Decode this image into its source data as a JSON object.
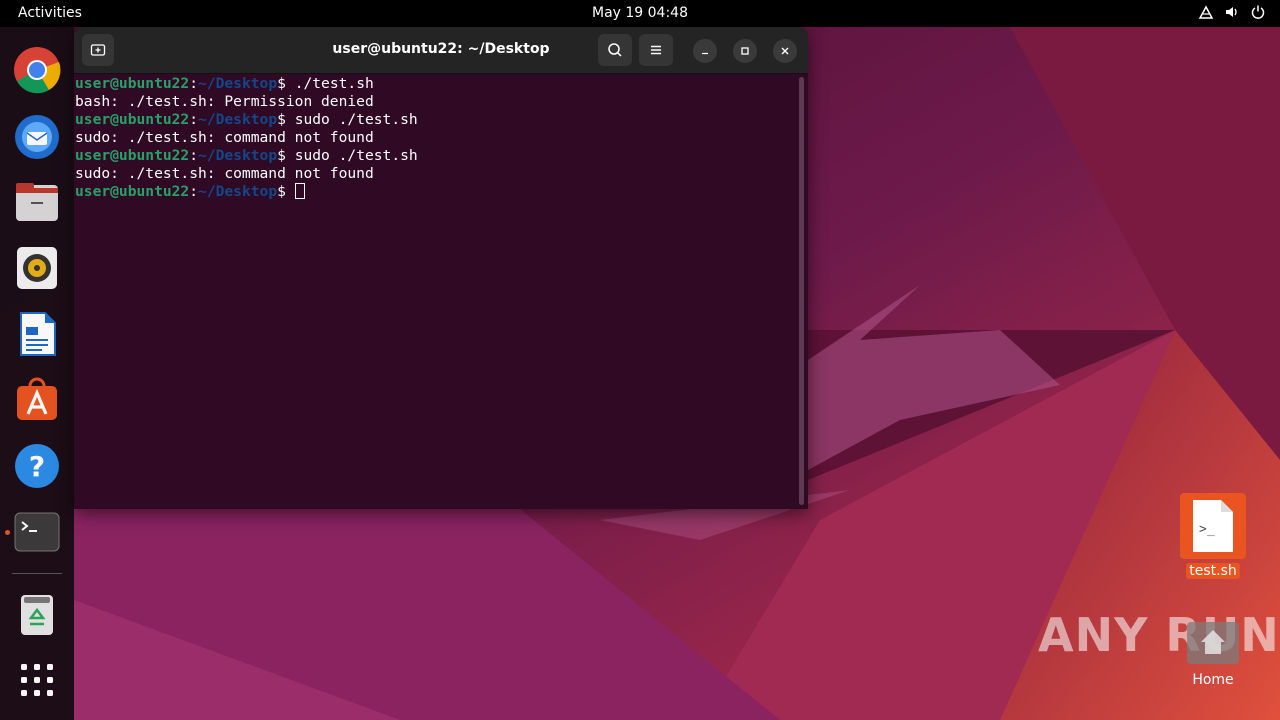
{
  "topbar": {
    "activities": "Activities",
    "clock": "May 19  04:48",
    "tray_icons": [
      "network-icon",
      "volume-icon",
      "power-icon"
    ]
  },
  "dock": {
    "items": [
      {
        "name": "chrome",
        "icon": "chrome-icon"
      },
      {
        "name": "thunderbird",
        "icon": "thunderbird-icon"
      },
      {
        "name": "files",
        "icon": "files-icon"
      },
      {
        "name": "rhythmbox",
        "icon": "rhythmbox-icon"
      },
      {
        "name": "libreoffice-writer",
        "icon": "writer-icon"
      },
      {
        "name": "app-center",
        "icon": "app-center-icon"
      },
      {
        "name": "help",
        "icon": "help-icon"
      },
      {
        "name": "terminal",
        "icon": "terminal-icon",
        "running": true
      },
      {
        "name": "trash",
        "icon": "trash-icon"
      },
      {
        "name": "show-apps",
        "icon": "app-grid-icon"
      }
    ]
  },
  "terminal": {
    "title": "user@ubuntu22: ~/Desktop",
    "prompt_user": "user@ubuntu22",
    "prompt_sep": ":",
    "prompt_path": "~/Desktop",
    "prompt_symbol": "$ ",
    "lines": [
      {
        "type": "cmd",
        "text": "./test.sh"
      },
      {
        "type": "out",
        "text": "bash: ./test.sh: Permission denied"
      },
      {
        "type": "cmd",
        "text": "sudo ./test.sh"
      },
      {
        "type": "out",
        "text": "sudo: ./test.sh: command not found"
      },
      {
        "type": "cmd",
        "text": "sudo ./test.sh"
      },
      {
        "type": "out",
        "text": "sudo: ./test.sh: command not found"
      },
      {
        "type": "cmd",
        "text": ""
      }
    ]
  },
  "desktop": {
    "file_label": "test.sh",
    "file_icon_text": ">_",
    "home_label": "Home"
  },
  "watermark": "ANY RUN",
  "colors": {
    "accent": "#e95420",
    "terminal_bg": "#300a24",
    "prompt_user": "#26a269",
    "prompt_path": "#12488b"
  }
}
